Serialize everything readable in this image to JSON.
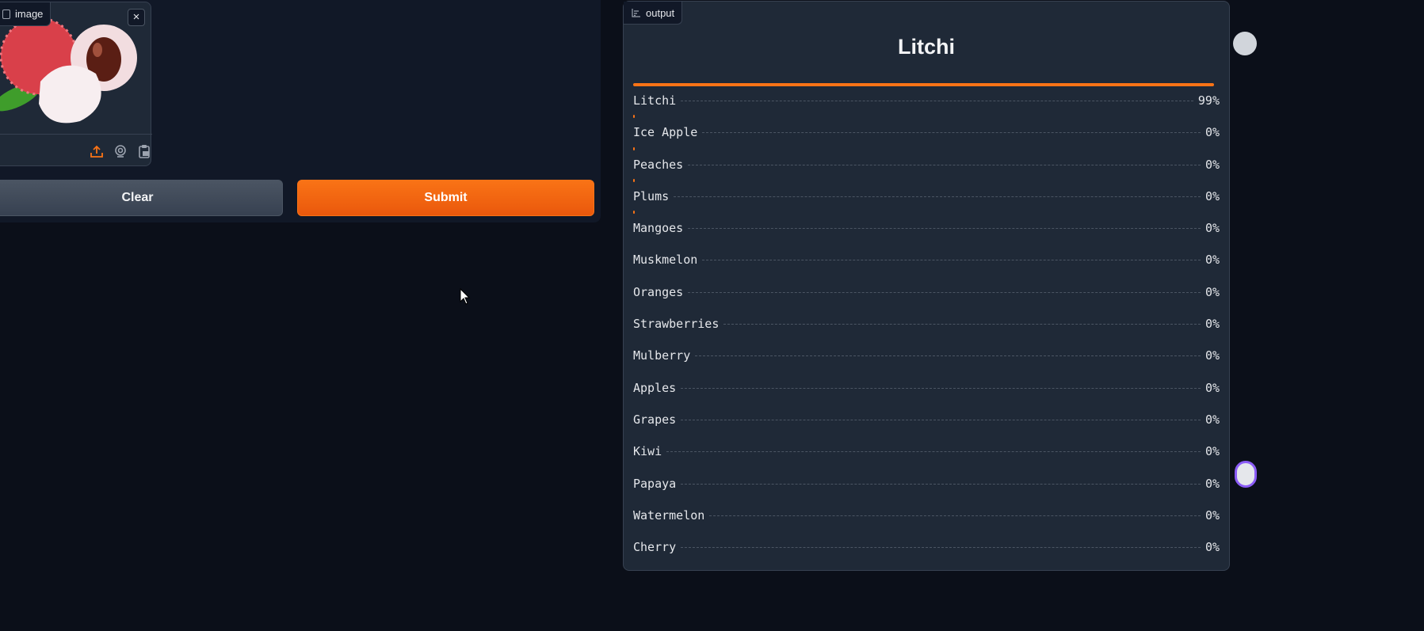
{
  "input": {
    "image_label": "image",
    "close_glyph": "×",
    "source_icons": [
      "upload-icon",
      "webcam-icon",
      "clipboard-icon"
    ]
  },
  "buttons": {
    "clear": "Clear",
    "submit": "Submit"
  },
  "output": {
    "label": "output",
    "title": "Litchi",
    "accent_color": "#f97316",
    "results": [
      {
        "label": "Litchi",
        "percent": "99%",
        "confidence": 0.99
      },
      {
        "label": "Ice Apple",
        "percent": "0%",
        "confidence": 0.002
      },
      {
        "label": "Peaches",
        "percent": "0%",
        "confidence": 0.002
      },
      {
        "label": "Plums",
        "percent": "0%",
        "confidence": 0.002
      },
      {
        "label": "Mangoes",
        "percent": "0%",
        "confidence": 0.001
      },
      {
        "label": "Muskmelon",
        "percent": "0%",
        "confidence": 0
      },
      {
        "label": "Oranges",
        "percent": "0%",
        "confidence": 0
      },
      {
        "label": "Strawberries",
        "percent": "0%",
        "confidence": 0
      },
      {
        "label": "Mulberry",
        "percent": "0%",
        "confidence": 0
      },
      {
        "label": "Apples",
        "percent": "0%",
        "confidence": 0
      },
      {
        "label": "Grapes",
        "percent": "0%",
        "confidence": 0
      },
      {
        "label": "Kiwi",
        "percent": "0%",
        "confidence": 0
      },
      {
        "label": "Papaya",
        "percent": "0%",
        "confidence": 0
      },
      {
        "label": "Watermelon",
        "percent": "0%",
        "confidence": 0
      },
      {
        "label": "Cherry",
        "percent": "0%",
        "confidence": 0
      }
    ]
  }
}
